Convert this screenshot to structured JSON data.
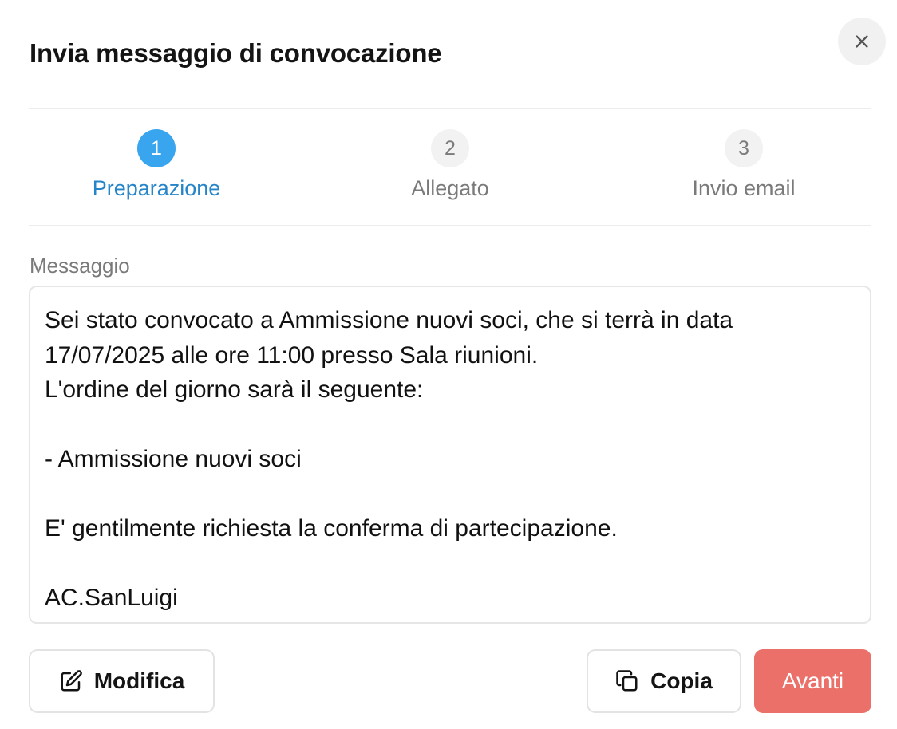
{
  "dialog": {
    "title": "Invia messaggio di convocazione",
    "close_icon": "close-icon"
  },
  "stepper": {
    "steps": [
      {
        "number": "1",
        "label": "Preparazione",
        "state": "active"
      },
      {
        "number": "2",
        "label": "Allegato",
        "state": "inactive"
      },
      {
        "number": "3",
        "label": "Invio email",
        "state": "inactive"
      }
    ]
  },
  "message": {
    "label": "Messaggio",
    "lines": [
      "Sei stato convocato a Ammissione nuovi soci, che si terrà in data",
      "17/07/2025 alle ore 11:00 presso Sala riunioni.",
      "L'ordine del giorno sarà il seguente:",
      "",
      "- Ammissione nuovi soci",
      "",
      "E' gentilmente richiesta la conferma di partecipazione.",
      "",
      "AC.SanLuigi"
    ]
  },
  "actions": {
    "modifica_label": "Modifica",
    "modifica_icon": "edit-icon",
    "copia_label": "Copia",
    "copia_icon": "copy-icon",
    "avanti_label": "Avanti"
  },
  "colors": {
    "accent": "#39a5ee",
    "accent_text": "#2585c8",
    "primary_button": "#eb706a"
  }
}
